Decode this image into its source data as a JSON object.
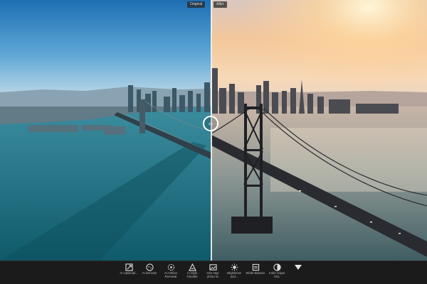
{
  "compare": {
    "original_label": "Original",
    "after_label": "After",
    "handle_glyph": "‹›"
  },
  "toolbar": {
    "tools": [
      {
        "label": "AI Upsampl...",
        "icon": "upscale-icon"
      },
      {
        "label": "AI Denoise",
        "icon": "denoise-icon"
      },
      {
        "label": "AI Artifact Removal",
        "icon": "artifact-icon"
      },
      {
        "label": "AI Style Transfer",
        "icon": "style-icon"
      },
      {
        "label": "One-step photo fix",
        "icon": "photo-fix-icon"
      },
      {
        "label": "Brightness and...",
        "icon": "brightness-icon"
      },
      {
        "label": "White Balance",
        "icon": "white-balance-icon"
      },
      {
        "label": "Color Adjust HSL",
        "icon": "color-hsl-icon"
      }
    ],
    "more_icon": "chevron-down-icon"
  }
}
